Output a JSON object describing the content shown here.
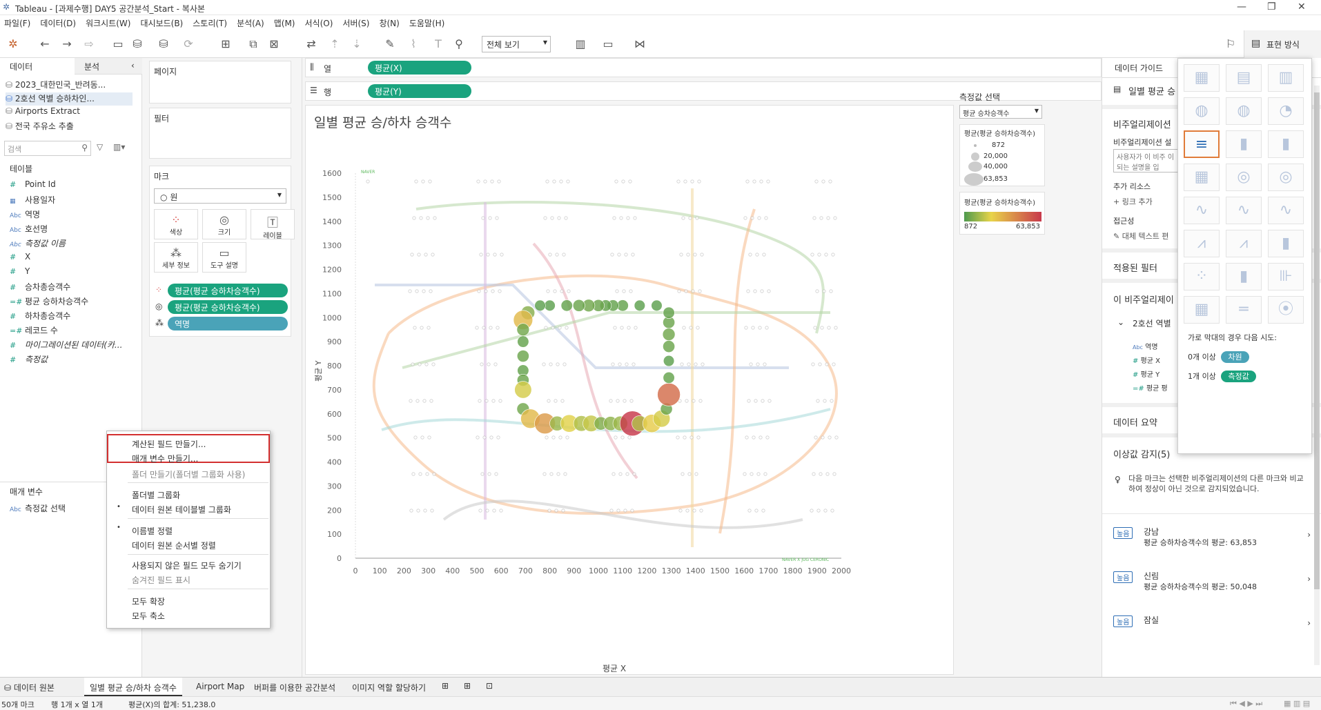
{
  "window": {
    "title": "Tableau - [과제수행] DAY5 공간분석_Start - 복사본"
  },
  "menu": [
    "파일(F)",
    "데이터(D)",
    "워크시트(W)",
    "대시보드(B)",
    "스토리(T)",
    "분석(A)",
    "맵(M)",
    "서식(O)",
    "서버(S)",
    "창(N)",
    "도움말(H)"
  ],
  "toolbar": {
    "view_combo": "전체 보기",
    "show_me_label": "표현 방식"
  },
  "left": {
    "tab_data": "데이터",
    "tab_analysis": "분석",
    "datasources": [
      "2023_대한민국_반려동...",
      "2호선 역별 승하차인...",
      "Airports Extract",
      "전국 주유소 추출"
    ],
    "search_placeholder": "검색",
    "tables_header": "테이블",
    "fields": [
      {
        "icon": "#",
        "name": "Point Id"
      },
      {
        "icon": "cal",
        "name": "사용일자"
      },
      {
        "icon": "Abc",
        "name": "역명"
      },
      {
        "icon": "Abc",
        "name": "호선명"
      },
      {
        "icon": "Abc",
        "name": "측정값 이름"
      },
      {
        "icon": "#",
        "name": "X"
      },
      {
        "icon": "#",
        "name": "Y"
      },
      {
        "icon": "#",
        "name": "승차총승객수"
      },
      {
        "icon": "=#",
        "name": "평균 승하차승객수"
      },
      {
        "icon": "#",
        "name": "하차총승객수"
      },
      {
        "icon": "=#",
        "name": "레코드 수"
      },
      {
        "icon": "#",
        "name": "마이그레이션된 데이터(카..."
      },
      {
        "icon": "#",
        "name": "측정값"
      }
    ],
    "params_header": "매개 변수",
    "params": [
      {
        "icon": "Abc",
        "name": "측정값 선택"
      }
    ]
  },
  "shelves": {
    "pages": "페이지",
    "filters": "필터",
    "marks": "마크",
    "mark_type": "원",
    "mark_buttons": [
      "색상",
      "크기",
      "레이블",
      "세부 정보",
      "도구 설명"
    ],
    "mark_pills": [
      "평균(평균 승하차승객수)",
      "평균(평균 승하차승객수)",
      "역명"
    ],
    "columns_label": "열",
    "columns_pill": "평균(X)",
    "rows_label": "행",
    "rows_pill": "평균(Y)"
  },
  "sheet": {
    "title": "일별 평균 승/하차 승객수",
    "xlabel": "평균 X",
    "ylabel": "평균 Y",
    "watermark_top": "NAVER",
    "watermark_bottom": "NAVER X JUG CERONIC"
  },
  "legends": {
    "param_title": "측정값 선택",
    "param_value": "평균 승차승객수",
    "size_title": "평균(평균 승하차승객수)",
    "size_values": [
      "872",
      "20,000",
      "40,000",
      "63,853"
    ],
    "color_title": "평균(평균 승하차승객수)",
    "color_min": "872",
    "color_max": "63,853",
    "colors": {
      "low": "#4e9a4e",
      "mid": "#e8d44a",
      "high": "#c8384b"
    }
  },
  "chart_data": {
    "type": "scatter",
    "xlabel": "평균 X",
    "ylabel": "평균 Y",
    "xlim": [
      0,
      2000
    ],
    "ylim": [
      0,
      1600
    ],
    "xticks": [
      0,
      100,
      200,
      300,
      400,
      500,
      600,
      700,
      800,
      900,
      1000,
      1100,
      1200,
      1300,
      1400,
      1500,
      1600,
      1700,
      1800,
      1900,
      2000
    ],
    "yticks": [
      0,
      100,
      200,
      300,
      400,
      500,
      600,
      700,
      800,
      900,
      1000,
      1100,
      1200,
      1300,
      1400,
      1500,
      1600
    ],
    "points": [
      {
        "x": 710,
        "y": 1020,
        "v": 9000
      },
      {
        "x": 690,
        "y": 990,
        "v": 30000
      },
      {
        "x": 690,
        "y": 950,
        "v": 6000
      },
      {
        "x": 690,
        "y": 900,
        "v": 4000
      },
      {
        "x": 690,
        "y": 840,
        "v": 5000
      },
      {
        "x": 690,
        "y": 780,
        "v": 4000
      },
      {
        "x": 690,
        "y": 740,
        "v": 5000
      },
      {
        "x": 690,
        "y": 700,
        "v": 20000
      },
      {
        "x": 690,
        "y": 620,
        "v": 6000
      },
      {
        "x": 720,
        "y": 580,
        "v": 30000
      },
      {
        "x": 780,
        "y": 560,
        "v": 38000
      },
      {
        "x": 830,
        "y": 560,
        "v": 12000
      },
      {
        "x": 880,
        "y": 560,
        "v": 22000
      },
      {
        "x": 930,
        "y": 560,
        "v": 15000
      },
      {
        "x": 970,
        "y": 560,
        "v": 18000
      },
      {
        "x": 1010,
        "y": 560,
        "v": 8000
      },
      {
        "x": 1050,
        "y": 560,
        "v": 10000
      },
      {
        "x": 1090,
        "y": 560,
        "v": 12000
      },
      {
        "x": 1140,
        "y": 560,
        "v": 63853
      },
      {
        "x": 1170,
        "y": 560,
        "v": 15000
      },
      {
        "x": 1220,
        "y": 560,
        "v": 25000
      },
      {
        "x": 1260,
        "y": 580,
        "v": 20000
      },
      {
        "x": 1280,
        "y": 620,
        "v": 5000
      },
      {
        "x": 1290,
        "y": 680,
        "v": 50048
      },
      {
        "x": 1290,
        "y": 750,
        "v": 4000
      },
      {
        "x": 1290,
        "y": 820,
        "v": 3000
      },
      {
        "x": 1290,
        "y": 880,
        "v": 5000
      },
      {
        "x": 1290,
        "y": 930,
        "v": 6000
      },
      {
        "x": 1290,
        "y": 980,
        "v": 5000
      },
      {
        "x": 1290,
        "y": 1020,
        "v": 4000
      },
      {
        "x": 1240,
        "y": 1050,
        "v": 3000
      },
      {
        "x": 1170,
        "y": 1050,
        "v": 3000
      },
      {
        "x": 1100,
        "y": 1050,
        "v": 4000
      },
      {
        "x": 1060,
        "y": 1050,
        "v": 4000
      },
      {
        "x": 1030,
        "y": 1050,
        "v": 4000
      },
      {
        "x": 1000,
        "y": 1050,
        "v": 5000
      },
      {
        "x": 960,
        "y": 1050,
        "v": 6000
      },
      {
        "x": 920,
        "y": 1050,
        "v": 5000
      },
      {
        "x": 870,
        "y": 1050,
        "v": 4000
      },
      {
        "x": 800,
        "y": 1050,
        "v": 3000
      },
      {
        "x": 760,
        "y": 1050,
        "v": 3000
      }
    ]
  },
  "right": {
    "data_guide": "데이터 가이드",
    "viz_name": "일별 평균 승",
    "viz_desc_header": "비주얼리제이션",
    "viz_desc_label": "비주얼리제이션 설",
    "viz_desc_placeholder": "사용자가 이 비주 이 되는 설명을 입",
    "resources": "추가 리소스",
    "add_link": "링크 추가",
    "accessibility": "접근성",
    "alt_text": "대체 텍스트 편",
    "applied_filters": "적용된 필터",
    "this_viz": "이 비주얼리제이",
    "ds_node": "2호선 역별",
    "ds_fields": [
      "역명",
      "평균 X",
      "평균 Y",
      "평균 평"
    ],
    "summary": "데이터 요약",
    "outliers": "이상값 감지(5)",
    "outlier_desc": "다음 마크는 선택한 비주얼리제이션의 다른 마크와 비교하여 정상이 아닌 것으로 감지되었습니다.",
    "outlier_items": [
      {
        "badge": "높음",
        "name": "강남",
        "desc": "평균 승하차승객수의 평균: 63,853"
      },
      {
        "badge": "높음",
        "name": "신림",
        "desc": "평균 승하차승객수의 평균: 50,048"
      },
      {
        "badge": "높음",
        "name": "잠실",
        "desc": ""
      }
    ]
  },
  "showme": {
    "hint": "가로 막대의 경우 다음 시도:",
    "req1_prefix": "0개 이상",
    "req1_pill": "차원",
    "req2_prefix": "1개 이상",
    "req2_pill": "측정값"
  },
  "context_menu": {
    "items": [
      "계산된 필드 만들기...",
      "매개 변수 만들기...",
      "폴더 만들기(폴더별 그룹화 사용)",
      "폴더별 그룹화",
      "데이터 원본 테이블별 그룹화",
      "이름별 정렬",
      "데이터 원본 순서별 정렬",
      "사용되지 않은 필드 모두 숨기기",
      "숨겨진 필드 표시",
      "모두 확장",
      "모두 축소"
    ]
  },
  "tabs": [
    "데이터 원본",
    "일별 평균 승/하차 승객수",
    "Airport Map",
    "버퍼를 이용한 공간분석",
    "이미지 역할 할당하기"
  ],
  "status": {
    "marks": "50개 마크",
    "rows_cols": "행 1개 x 열 1개",
    "sum": "평균(X)의 합계: 51,238.0"
  }
}
